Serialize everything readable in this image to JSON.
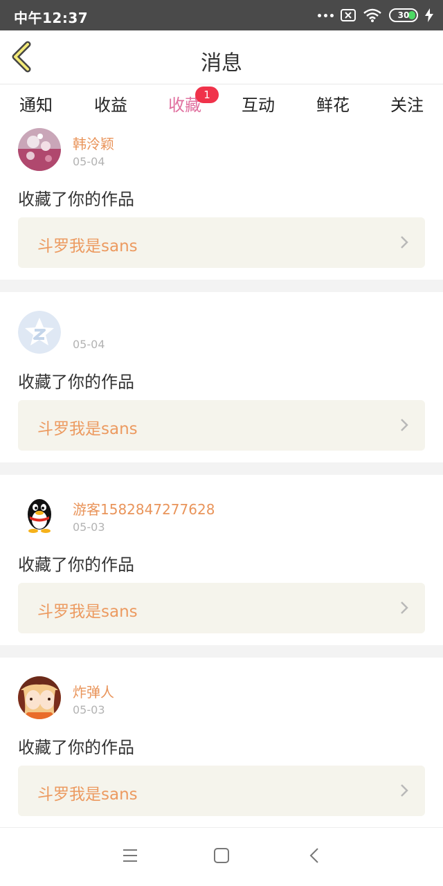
{
  "status_bar": {
    "time": "中午12:37",
    "battery": "30"
  },
  "header": {
    "title": "消息"
  },
  "tabs": [
    {
      "label": "通知",
      "active": false
    },
    {
      "label": "收益",
      "active": false
    },
    {
      "label": "收藏",
      "active": true,
      "badge": "1"
    },
    {
      "label": "互动",
      "active": false
    },
    {
      "label": "鲜花",
      "active": false
    },
    {
      "label": "关注",
      "active": false
    }
  ],
  "messages": [
    {
      "user": "韩泠颖",
      "date": "05-04",
      "text": "收藏了你的作品",
      "work_title": "斗罗我是sans",
      "avatar": "photo-avatar"
    },
    {
      "user": "",
      "date": "05-04",
      "text": "收藏了你的作品",
      "work_title": "斗罗我是sans",
      "avatar": "qzone-star-avatar"
    },
    {
      "user": "游客1582847277628",
      "date": "05-03",
      "text": "收藏了你的作品",
      "work_title": "斗罗我是sans",
      "avatar": "penguin-avatar"
    },
    {
      "user": "炸弹人",
      "date": "05-03",
      "text": "收藏了你的作品",
      "work_title": "斗罗我是sans",
      "avatar": "anime-avatar"
    }
  ],
  "colors": {
    "accent": "#e0709f",
    "username": "#e9945a",
    "badge": "#f0324a",
    "work_box_bg": "#f5f4ec"
  }
}
